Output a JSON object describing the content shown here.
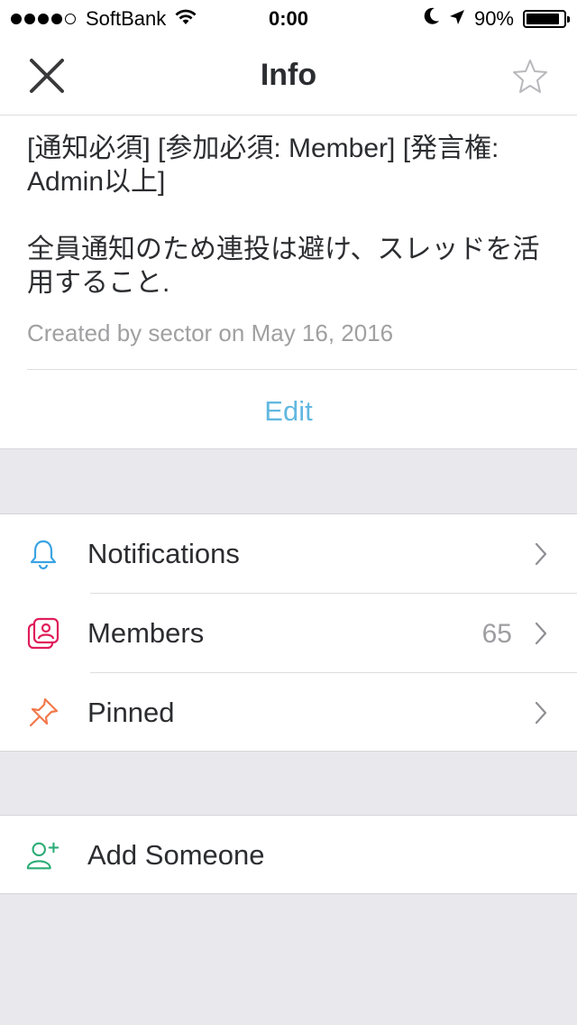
{
  "status_bar": {
    "carrier": "SoftBank",
    "time": "0:00",
    "battery": "90%",
    "battery_level": 0.9,
    "signal_bars_filled": 4,
    "signal_bars_total": 5
  },
  "nav": {
    "title": "Info",
    "close_icon": "close-icon",
    "star_icon": "star-icon"
  },
  "channel": {
    "purpose_line1": "[通知必須] [参加必須: Member] [発言権: Admin以上]",
    "purpose_line2": "全員通知のため連投は避け、スレッドを活用すること.",
    "created": "Created by sector on May 16, 2016",
    "edit_label": "Edit"
  },
  "menu": {
    "items": [
      {
        "label": "Notifications",
        "count": "",
        "icon": "bell-icon",
        "color": "#3aa3e3"
      },
      {
        "label": "Members",
        "count": "65",
        "icon": "members-icon",
        "color": "#e01e5a"
      },
      {
        "label": "Pinned",
        "count": "",
        "icon": "pin-icon",
        "color": "#f2784b"
      }
    ],
    "add_someone": {
      "label": "Add Someone",
      "icon": "add-user-icon",
      "color": "#2bac76"
    }
  },
  "colors": {
    "link": "#62b8e0",
    "background": "#e9e9ed",
    "text": "#2c2d30",
    "muted": "#a0a0a2"
  }
}
